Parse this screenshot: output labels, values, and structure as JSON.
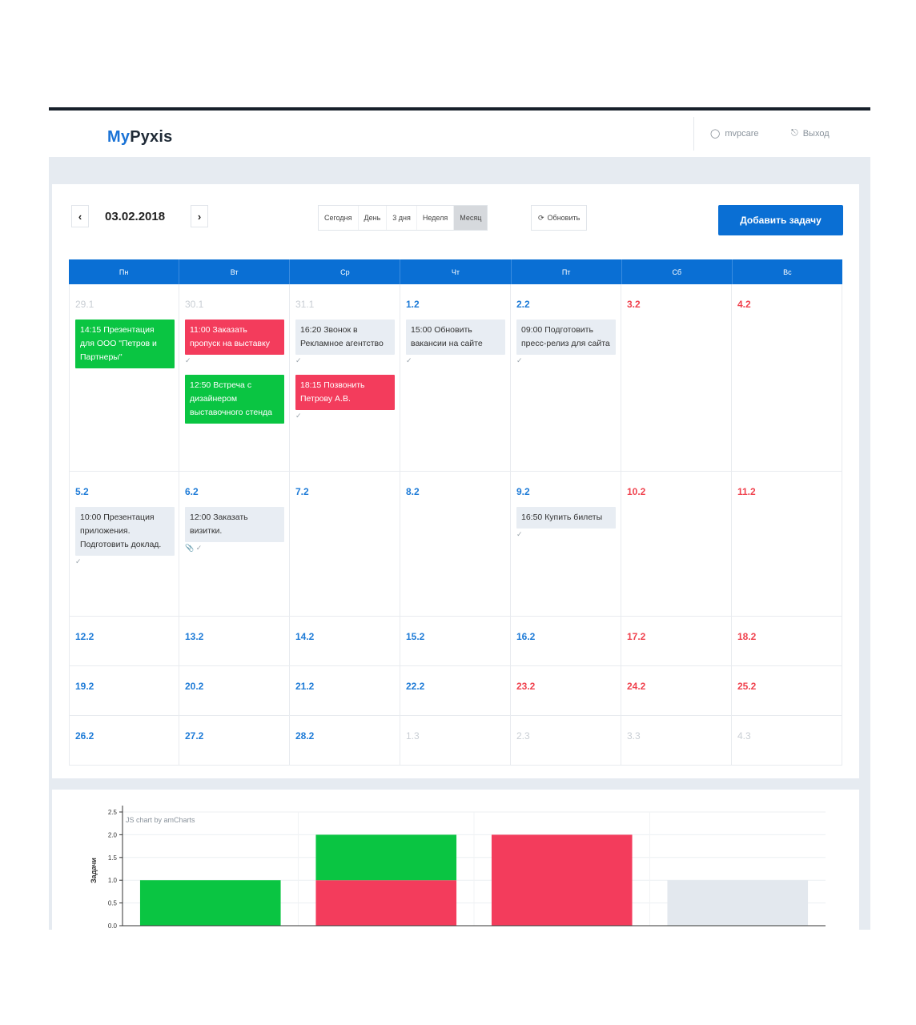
{
  "app": {
    "logo_part1": "My",
    "logo_part2": "Pyxis"
  },
  "header": {
    "user_icon": "user-icon",
    "user_label": "mvpcare",
    "logout_icon": "logout-icon",
    "logout_label": "Выход"
  },
  "toolbar": {
    "prev_icon": "chevron-left-icon",
    "next_icon": "chevron-right-icon",
    "current_date": "03.02.2018",
    "views": [
      "Сегодня",
      "День",
      "3 дня",
      "Неделя",
      "Месяц"
    ],
    "active_view": "Месяц",
    "refresh_label": "Обновить",
    "add_task_label": "Добавить задачу"
  },
  "calendar": {
    "weekdays": [
      "Пн",
      "Вт",
      "Ср",
      "Чт",
      "Пт",
      "Сб",
      "Вс"
    ],
    "weeks": [
      [
        {
          "day": "29.1",
          "kind": "muted",
          "events": [
            {
              "text": "14:15 Презентация для ООО \"Петров и Партнеры\"",
              "color": "green"
            }
          ]
        },
        {
          "day": "30.1",
          "kind": "muted",
          "events": [
            {
              "text": "11:00 Заказать пропуск на выставку",
              "color": "red",
              "check": "✓"
            },
            {
              "text": "12:50 Встреча с дизайнером выставочного стенда",
              "color": "green"
            }
          ]
        },
        {
          "day": "31.1",
          "kind": "muted",
          "events": [
            {
              "text": "16:20 Звонок в Рекламное агентство",
              "color": "gray",
              "check": "✓"
            },
            {
              "text": "18:15 Позвонить Петрову А.В.",
              "color": "red",
              "check": "✓"
            }
          ]
        },
        {
          "day": "1.2",
          "kind": "normal",
          "events": [
            {
              "text": "15:00 Обновить вакансии на сайте",
              "color": "gray",
              "check": "✓"
            }
          ]
        },
        {
          "day": "2.2",
          "kind": "normal",
          "events": [
            {
              "text": "09:00 Подготовить пресс-релиз для сайта",
              "color": "gray",
              "check": "✓"
            }
          ]
        },
        {
          "day": "3.2",
          "kind": "weekend",
          "events": []
        },
        {
          "day": "4.2",
          "kind": "weekend",
          "events": []
        }
      ],
      [
        {
          "day": "5.2",
          "kind": "normal",
          "events": [
            {
              "text": "10:00 Презентация приложения. Подготовить доклад.",
              "color": "gray",
              "check": "✓"
            }
          ]
        },
        {
          "day": "6.2",
          "kind": "normal",
          "events": [
            {
              "text": "12:00 Заказать визитки.",
              "color": "gray",
              "check": "📎 ✓"
            }
          ]
        },
        {
          "day": "7.2",
          "kind": "normal",
          "events": []
        },
        {
          "day": "8.2",
          "kind": "normal",
          "events": []
        },
        {
          "day": "9.2",
          "kind": "normal",
          "events": [
            {
              "text": "16:50 Купить билеты",
              "color": "gray",
              "check": "✓"
            }
          ]
        },
        {
          "day": "10.2",
          "kind": "weekend",
          "events": []
        },
        {
          "day": "11.2",
          "kind": "weekend",
          "events": []
        }
      ],
      [
        {
          "day": "12.2",
          "kind": "normal",
          "events": []
        },
        {
          "day": "13.2",
          "kind": "normal",
          "events": []
        },
        {
          "day": "14.2",
          "kind": "normal",
          "events": []
        },
        {
          "day": "15.2",
          "kind": "normal",
          "events": []
        },
        {
          "day": "16.2",
          "kind": "normal",
          "events": []
        },
        {
          "day": "17.2",
          "kind": "weekend",
          "events": []
        },
        {
          "day": "18.2",
          "kind": "weekend",
          "events": []
        }
      ],
      [
        {
          "day": "19.2",
          "kind": "normal",
          "events": []
        },
        {
          "day": "20.2",
          "kind": "normal",
          "events": []
        },
        {
          "day": "21.2",
          "kind": "normal",
          "events": []
        },
        {
          "day": "22.2",
          "kind": "normal",
          "events": []
        },
        {
          "day": "23.2",
          "kind": "weekend",
          "events": []
        },
        {
          "day": "24.2",
          "kind": "weekend",
          "events": []
        },
        {
          "day": "25.2",
          "kind": "weekend",
          "events": []
        }
      ],
      [
        {
          "day": "26.2",
          "kind": "normal",
          "events": []
        },
        {
          "day": "27.2",
          "kind": "normal",
          "events": []
        },
        {
          "day": "28.2",
          "kind": "normal",
          "events": []
        },
        {
          "day": "1.3",
          "kind": "muted",
          "events": []
        },
        {
          "day": "2.3",
          "kind": "muted",
          "events": []
        },
        {
          "day": "3.3",
          "kind": "muted",
          "events": []
        },
        {
          "day": "4.3",
          "kind": "muted",
          "events": []
        }
      ]
    ]
  },
  "colors": {
    "brand": "#0a6fd4",
    "green": "#0ac542",
    "red": "#f33c5c",
    "gray": "#e3e8ee",
    "weekend_text": "#f0424e"
  },
  "chart_credit": "JS chart by amCharts",
  "chart_data": {
    "type": "bar",
    "stacked": true,
    "ylabel": "Задачи",
    "ylim": [
      0,
      2.5
    ],
    "yticks": [
      "0.0",
      "0.5",
      "1.0",
      "1.5",
      "2.0",
      "2.5"
    ],
    "categories": [
      "",
      "",
      "",
      ""
    ],
    "series": [
      {
        "color": "#f33c5c",
        "values": [
          0,
          1,
          2,
          0
        ]
      },
      {
        "color": "#0ac542",
        "values": [
          1,
          1,
          0,
          0
        ]
      },
      {
        "color": "#e3e8ee",
        "values": [
          0,
          0,
          0,
          1
        ]
      }
    ],
    "grid": true
  }
}
